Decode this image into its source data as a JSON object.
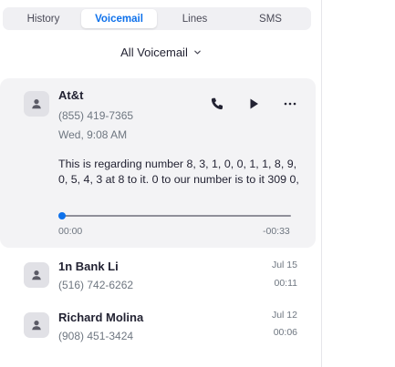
{
  "tabs": [
    {
      "label": "History"
    },
    {
      "label": "Voicemail"
    },
    {
      "label": "Lines"
    },
    {
      "label": "SMS"
    }
  ],
  "active_tab": "Voicemail",
  "filter": {
    "label": "All Voicemail"
  },
  "expanded": {
    "name": "At&t",
    "number": "(855) 419-7365",
    "datetime": "Wed, 9:08 AM",
    "transcript": "This is regarding number 8, 3, 1, 0, 0, 1, 1, 8, 9, 0, 5, 4, 3 at 8 to it. 0 to our number is to it 309 0,",
    "elapsed": "00:00",
    "remaining": "-00:33",
    "progress": 0
  },
  "voicemails": [
    {
      "name": "1n Bank Li",
      "number": "(516) 742-6262",
      "date": "Jul 15",
      "duration": "00:11"
    },
    {
      "name": "Richard Molina",
      "number": "(908) 451-3424",
      "date": "Jul 12",
      "duration": "00:06"
    }
  ],
  "colors": {
    "accent": "#0e71eb",
    "card": "#f3f3f5",
    "muted": "#6e7680"
  }
}
